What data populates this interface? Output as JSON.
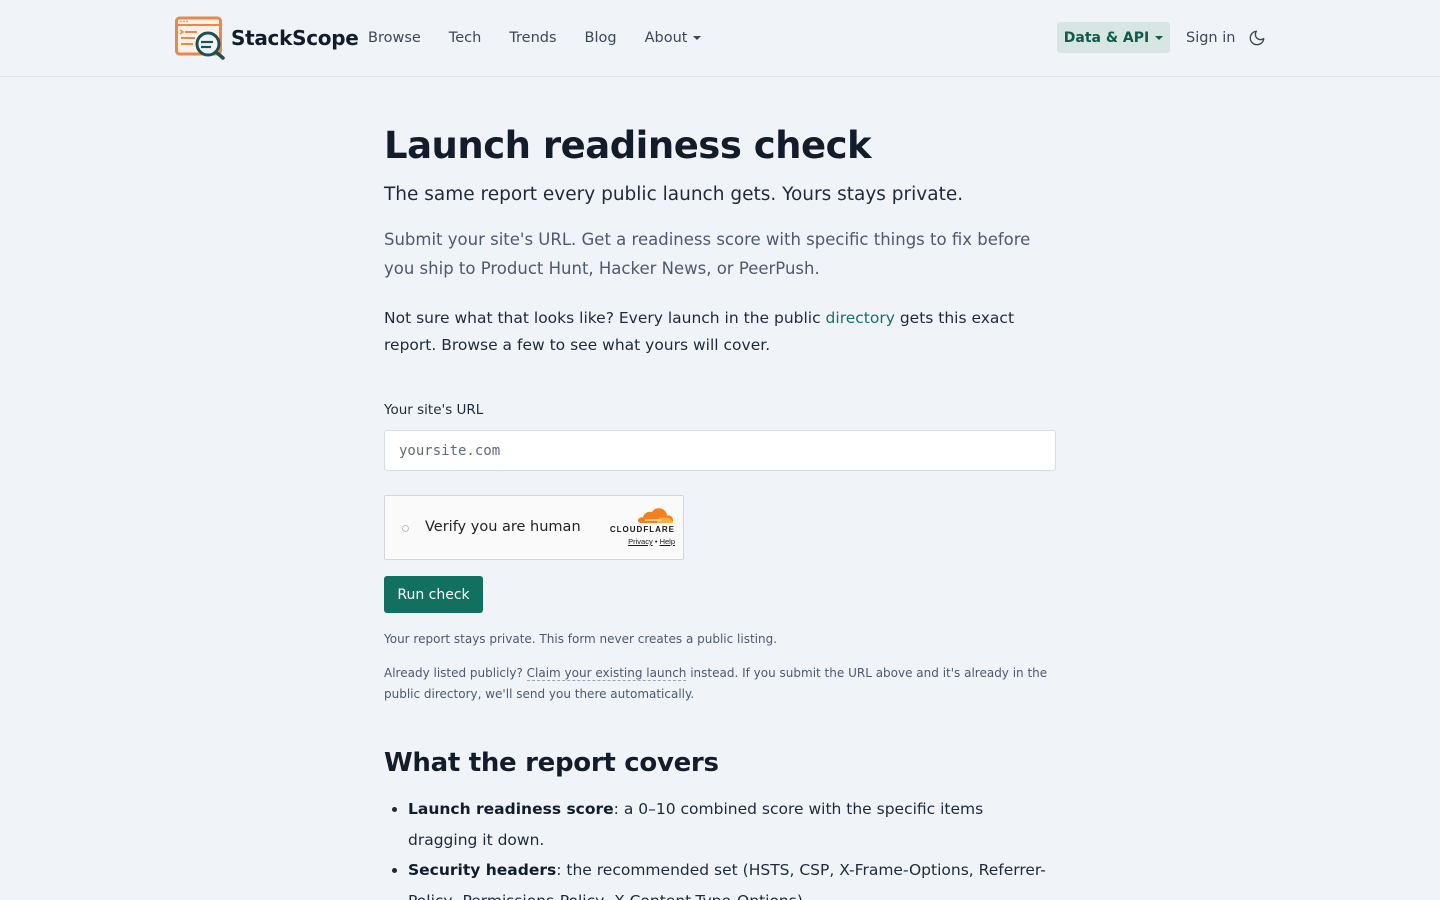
{
  "brand": {
    "name": "StackScope"
  },
  "nav": {
    "browse": "Browse",
    "tech": "Tech",
    "trends": "Trends",
    "blog": "Blog",
    "about": "About",
    "data_api": "Data & API",
    "sign_in": "Sign in",
    "theme_icon": "moon-icon"
  },
  "page": {
    "title": "Launch readiness check",
    "subtitle": "The same report every public launch gets. Yours stays private.",
    "intro": "Submit your site's URL. Get a readiness score with specific things to fix before you ship to Product Hunt, Hacker News, or PeerPush.",
    "notsure_before": "Not sure what that looks like? Every launch in the public ",
    "notsure_link": "directory",
    "notsure_after": " gets this exact report. Browse a few to see what yours will cover."
  },
  "form": {
    "url_label": "Your site's URL",
    "url_placeholder": "yoursite.com",
    "url_value": "",
    "captcha": {
      "label": "Verify you are human",
      "brand": "CLOUDFLARE",
      "privacy": "Privacy",
      "separator": "•",
      "help": "Help"
    },
    "submit_label": "Run check",
    "private_note": "Your report stays private. This form never creates a public listing.",
    "already_before": "Already listed publicly? ",
    "already_link": "Claim your existing launch",
    "already_after": " instead. If you submit the URL above and it's already in the public directory, we'll send you there automatically."
  },
  "covers": {
    "heading": "What the report covers",
    "items": [
      {
        "term": "Launch readiness score",
        "desc": ": a 0–10 combined score with the specific items dragging it down."
      },
      {
        "term": "Security headers",
        "desc": ": the recommended set (HSTS, CSP, X-Frame-Options, Referrer-Policy, Permissions-Policy, X-Content-Type-Options)."
      }
    ]
  },
  "colors": {
    "accent": "#11705f",
    "link": "#157265",
    "background": "#f0f4f8",
    "logo_orange": "#e8894a",
    "logo_teal": "#1d4f54",
    "cloudflare_orange": "#f38020"
  }
}
